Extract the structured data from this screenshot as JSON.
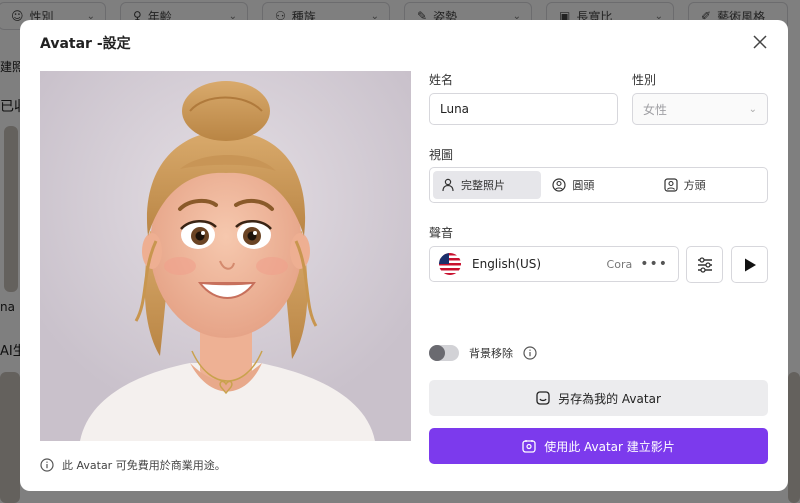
{
  "background": {
    "filters": [
      "性別",
      "年齡",
      "種族",
      "姿勢",
      "長寬比",
      "藝術風格"
    ],
    "labels": [
      "建照",
      "已收",
      "na",
      "AI生"
    ]
  },
  "modal": {
    "title": "Avatar -設定",
    "close_icon": "close-icon",
    "footnote": "此 Avatar 可免費用於商業用途。",
    "form": {
      "name_label": "姓名",
      "name_value": "Luna",
      "gender_label": "性別",
      "gender_value": "女性",
      "view_label": "視圖",
      "view_options": [
        "完整照片",
        "圓頭",
        "方頭"
      ],
      "view_selected": "完整照片",
      "voice_label": "聲音",
      "voice_language": "English(US)",
      "voice_name": "Cora",
      "voice_more": "•••",
      "bg_remove_label": "背景移除",
      "bg_remove_on": false,
      "save_button": "另存為我的 Avatar",
      "use_button": "使用此 Avatar 建立影片"
    }
  },
  "colors": {
    "primary": "#7c3aed",
    "overlay": "rgba(0,0,0,0.5)"
  }
}
